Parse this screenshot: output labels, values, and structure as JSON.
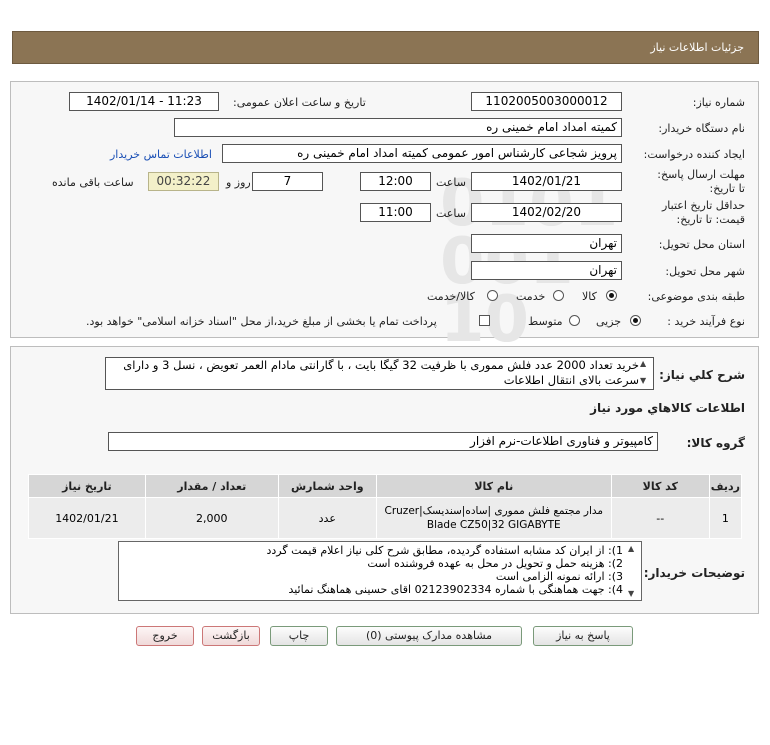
{
  "page_title": "جزئيات اطلاعات نياز",
  "fields": {
    "need_number_label": "شماره نياز:",
    "need_number": "1102005003000012",
    "announce_label": "تاريخ و ساعت اعلان عمومی:",
    "announce_value": "1402/01/14 - 11:23",
    "buyer_org_label": "نام دستگاه خريدار:",
    "buyer_org": "کمیته امداد امام خمینی ره",
    "requester_label": "ایجاد کننده درخواست:",
    "requester": "پرویز شجاعی کارشناس امور عمومی کمیته امداد امام خمینی ره",
    "contact_link": "اطلاعات تماس خريدار",
    "send_deadline_label": "مهلت ارسال پاسخ: تا تاريخ:",
    "send_deadline_date": "1402/01/21",
    "time_label": "ساعت",
    "send_deadline_time": "12:00",
    "days_value": "7",
    "days_label": "روز و",
    "remaining_time": "00:32:22",
    "remaining_label": "ساعت باقی مانده",
    "validity_label": "حداقل تاريخ اعتبار قيمت: تا تاريخ:",
    "validity_date": "1402/02/20",
    "validity_time": "11:00",
    "delivery_province_label": "استان محل تحويل:",
    "delivery_province": "تهران",
    "delivery_city_label": "شهر محل تحويل:",
    "delivery_city": "تهران",
    "category_label": "طبقه بندی موضوعی:",
    "category_options": [
      "کالا",
      "خدمت",
      "کالا/خدمت"
    ],
    "purchase_type_label": "نوع فرآيند خريد :",
    "purchase_options": [
      "جزيی",
      "متوسط"
    ],
    "payment_note": "پرداخت تمام يا بخشی از مبلغ خريد،از محل \"اسناد خزانه اسلامی\" خواهد بود."
  },
  "summary": {
    "label": "شرح كلي نياز:",
    "text": "خرید تعداد 2000 عدد فلش مموری با ظرفیت 32 گیگا بایت ، با گارانتی مادام العمر تعویض ، نسل 3 و دارای سرعت بالای انتقال اطلاعات"
  },
  "goods_section_title": "اطلاعات كالاهاي مورد نياز",
  "goods_group_label": "گروه کالا:",
  "goods_group": "کامپیوتر و فناوری اطلاعات-نرم افزار",
  "table": {
    "headers": [
      "رديف",
      "کد کالا",
      "نام کالا",
      "واحد شمارش",
      "تعداد / مقدار",
      "تاريخ نياز"
    ],
    "rows": [
      [
        "1",
        "--",
        "مدار مجتمع فلش مموری |ساده|سندیسک|Cruzer Blade CZ50|32 GIGABYTE",
        "عدد",
        "2,000",
        "1402/01/21"
      ]
    ]
  },
  "buyer_notes_label": "توضيحات خريدار:",
  "buyer_notes": [
    "1): از ایران کد مشابه استفاده گردیده، مطابق شرح کلی نیاز اعلام قیمت گردد",
    "2): هزینه حمل و تحویل در محل به عهده فروشنده است",
    "3): ارائه نمونه الزامی است",
    "4): جهت هماهنگی با شماره 02123902334 اقای حسینی هماهنگ نمائید"
  ],
  "buttons": {
    "reply": "پاسخ به نياز",
    "attachments": "مشاهده مدارک پيوستی (0)",
    "print": "چاپ",
    "back": "بازگشت",
    "exit": "خروج"
  },
  "watermark": {
    "brand": "ParsNamadData",
    "phone": "۰۲۱-۸۸۳۴۹۶۷۰"
  },
  "colors": {
    "title_bar": "#8b7454",
    "link": "#1a4fb5",
    "remaining_bg": "#f3f0c9"
  }
}
